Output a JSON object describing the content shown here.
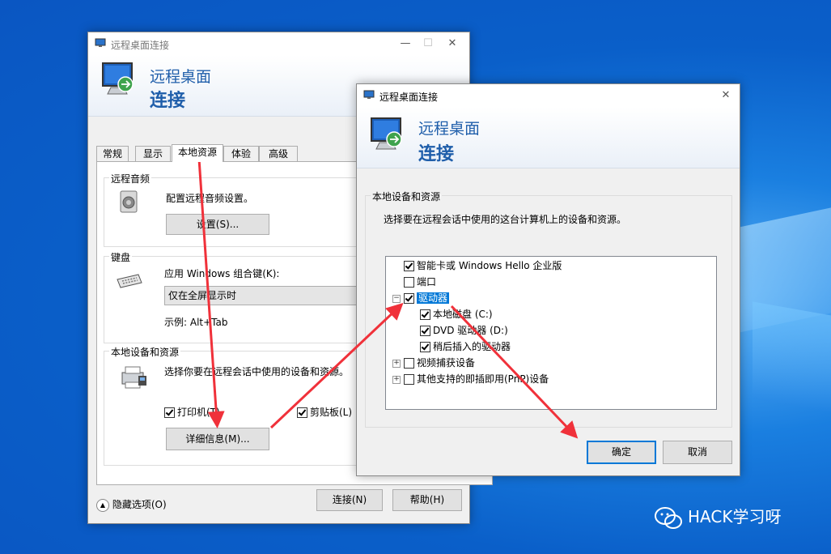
{
  "desktop": {
    "watermark": "HACK学习呀"
  },
  "main_window": {
    "title": "远程桌面连接",
    "banner_line1": "远程桌面",
    "banner_line2": "连接",
    "tabs": [
      "常规",
      "显示",
      "本地资源",
      "体验",
      "高级"
    ],
    "audio": {
      "group": "远程音频",
      "desc": "配置远程音频设置。",
      "settings_button": "设置(S)..."
    },
    "keyboard": {
      "group": "键盘",
      "desc": "应用 Windows 组合键(K):",
      "select_value": "仅在全屏显示时",
      "example": "示例: Alt+Tab"
    },
    "local": {
      "group": "本地设备和资源",
      "desc": "选择你要在远程会话中使用的设备和资源。",
      "printer": "打印机(T)",
      "clipboard": "剪贴板(L)",
      "details_button": "详细信息(M)..."
    },
    "hide_options": "隐藏选项(O)",
    "connect_button": "连接(N)",
    "help_button": "帮助(H)"
  },
  "dialog": {
    "title": "远程桌面连接",
    "banner_line1": "远程桌面",
    "banner_line2": "连接",
    "group": "本地设备和资源",
    "desc": "选择要在远程会话中使用的这台计算机上的设备和资源。",
    "items": {
      "smartcard": "智能卡或 Windows Hello 企业版",
      "port": "端口",
      "drives": "驱动器",
      "local_disk": "本地磁盘 (C:)",
      "dvd": "DVD 驱动器 (D:)",
      "later": "稍后插入的驱动器",
      "video": "视频捕获设备",
      "pnp": "其他支持的即插即用(PnP)设备"
    },
    "ok_button": "确定",
    "cancel_button": "取消"
  },
  "colors": {
    "arrow": "#f0313a",
    "accent": "#0078d7",
    "banner_text": "#1f5eaa"
  }
}
